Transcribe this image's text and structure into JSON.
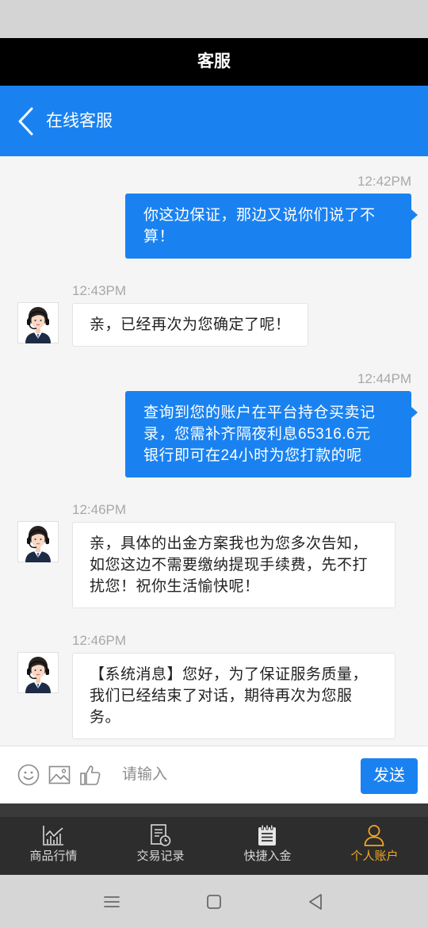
{
  "title_bar": {
    "title": "客服"
  },
  "header": {
    "title": "在线客服",
    "back_icon": "chevron-left-icon"
  },
  "messages": [
    {
      "time": "12:42PM",
      "text": "你这边保证，那边又说你们说了不算！"
    },
    {
      "time": "12:43PM",
      "text": "亲，已经再次为您确定了呢！"
    },
    {
      "time": "12:44PM",
      "text": "查询到您的账户在平台持仓买卖记录，您需补齐隔夜利息65316.6元银行即可在24小时为您打款的呢"
    },
    {
      "time": "12:46PM",
      "text": "亲，具体的出金方案我也为您多次告知，如您这边不需要缴纳提现手续费，先不打扰您！祝你生活愉快呢！"
    },
    {
      "time": "12:46PM",
      "text": "【系统消息】您好，为了保证服务质量，我们已经结束了对话，期待再次为您服务。"
    }
  ],
  "input_bar": {
    "placeholder": "请输入",
    "send_label": "发送",
    "icons": [
      "smiley-icon",
      "image-icon",
      "thumbs-up-icon"
    ]
  },
  "bottom_nav": {
    "items": [
      {
        "label": "商品行情",
        "icon": "market-chart-icon",
        "active": false
      },
      {
        "label": "交易记录",
        "icon": "trade-record-icon",
        "active": false
      },
      {
        "label": "快捷入金",
        "icon": "quick-deposit-icon",
        "active": false
      },
      {
        "label": "个人账户",
        "icon": "account-icon",
        "active": true
      }
    ]
  },
  "system_nav": {
    "icons": [
      "menu-icon",
      "home-icon",
      "back-icon"
    ]
  },
  "colors": {
    "brand_blue": "#1a82f0",
    "active_nav": "#f3a623",
    "title_bar": "#000000",
    "chat_background": "#f5f5f5"
  }
}
